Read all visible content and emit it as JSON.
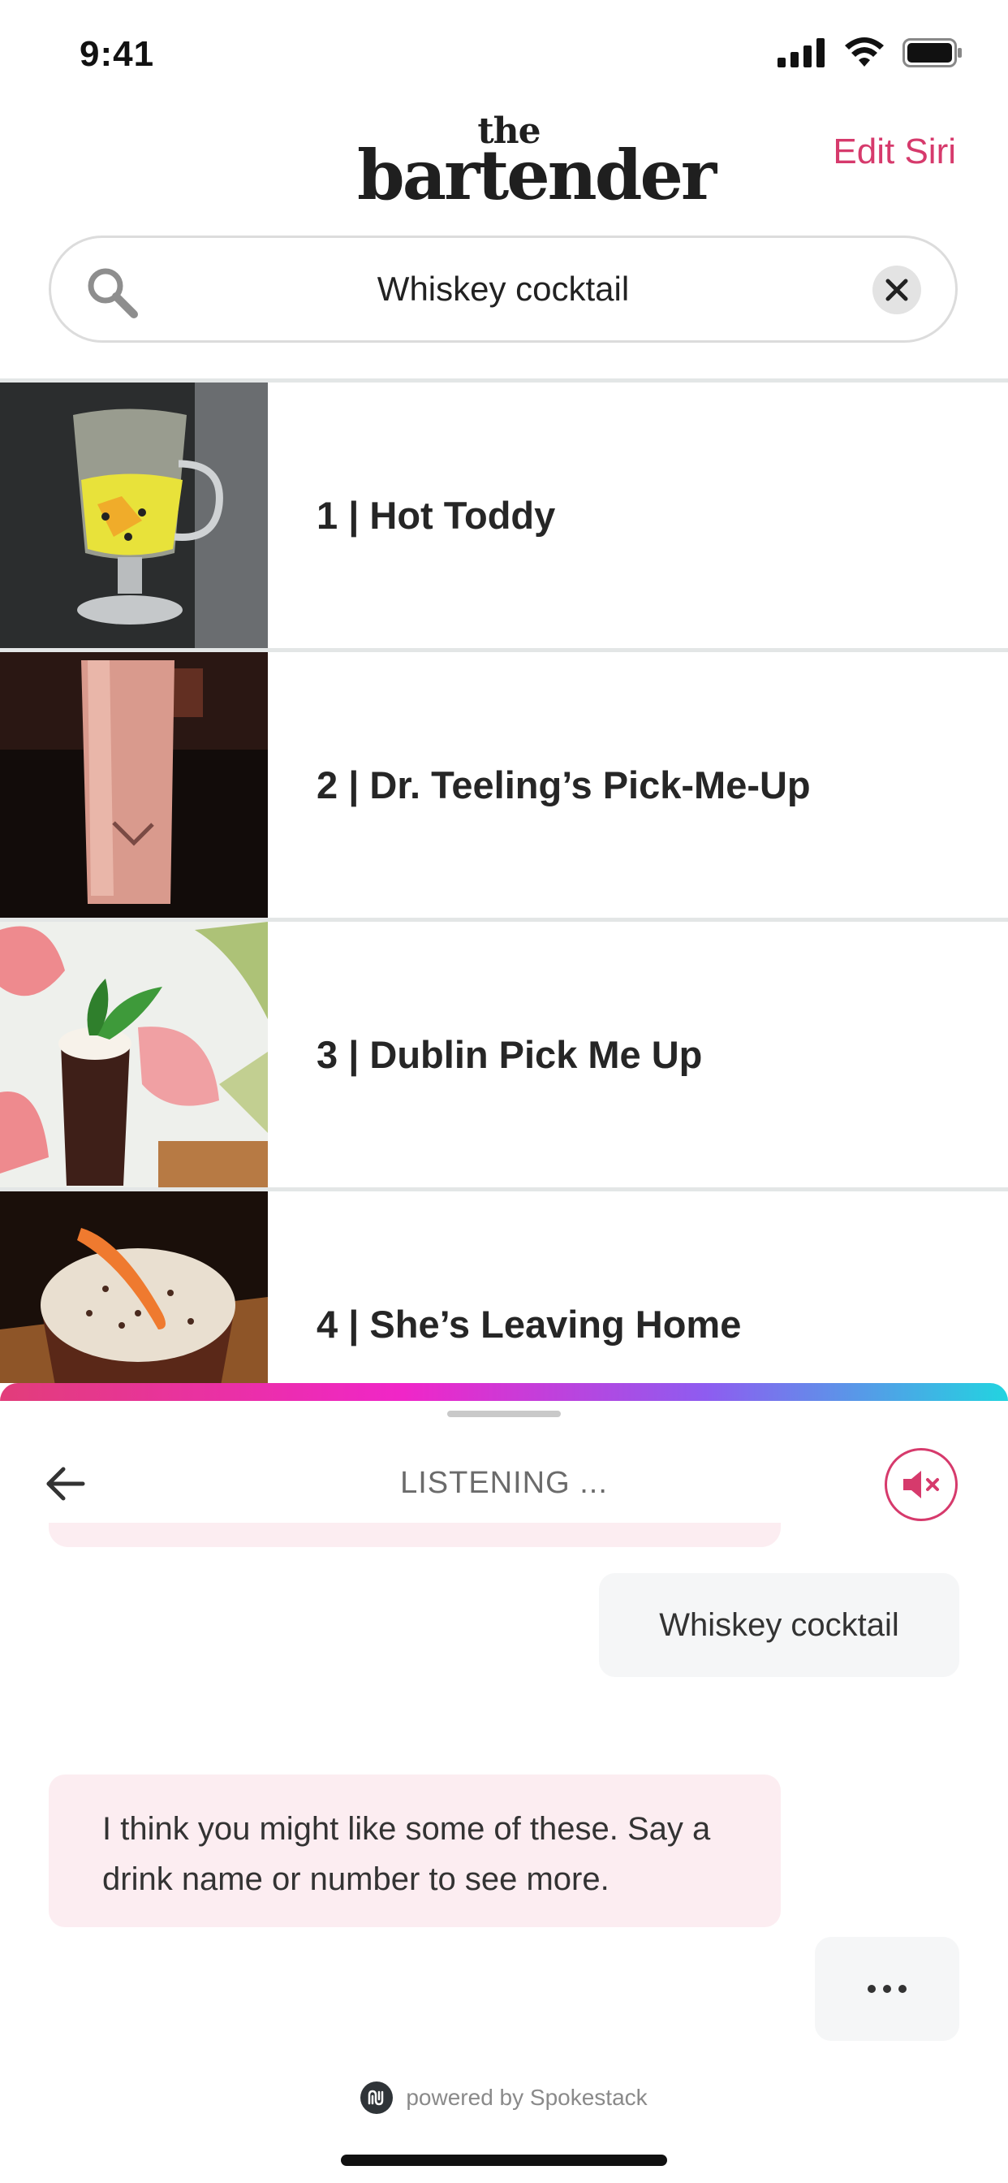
{
  "status_bar": {
    "time": "9:41"
  },
  "header": {
    "logo_the": "the",
    "logo_bartender": "bartender",
    "edit_siri": "Edit Siri"
  },
  "search": {
    "value": "Whiskey cocktail"
  },
  "results": [
    {
      "label": "1 | Hot Toddy"
    },
    {
      "label": "2 | Dr. Teeling’s Pick-Me-Up"
    },
    {
      "label": "3 | Dublin Pick Me Up"
    },
    {
      "label": "4 | She’s Leaving Home"
    }
  ],
  "assistant": {
    "status": "LISTENING ...",
    "user_message": "Whiskey cocktail",
    "bot_message": "I think you might like some of these. Say a drink name or number to see more.",
    "powered_by": "powered by Spokestack"
  },
  "colors": {
    "accent": "#d63a6c",
    "bot_bubble": "#fcedf1",
    "user_bubble": "#f5f6f7"
  },
  "icons": [
    "signal-icon",
    "wifi-icon",
    "battery-icon",
    "search-icon",
    "clear-icon",
    "back-arrow-icon",
    "mute-icon",
    "spokestack-logo-icon"
  ]
}
